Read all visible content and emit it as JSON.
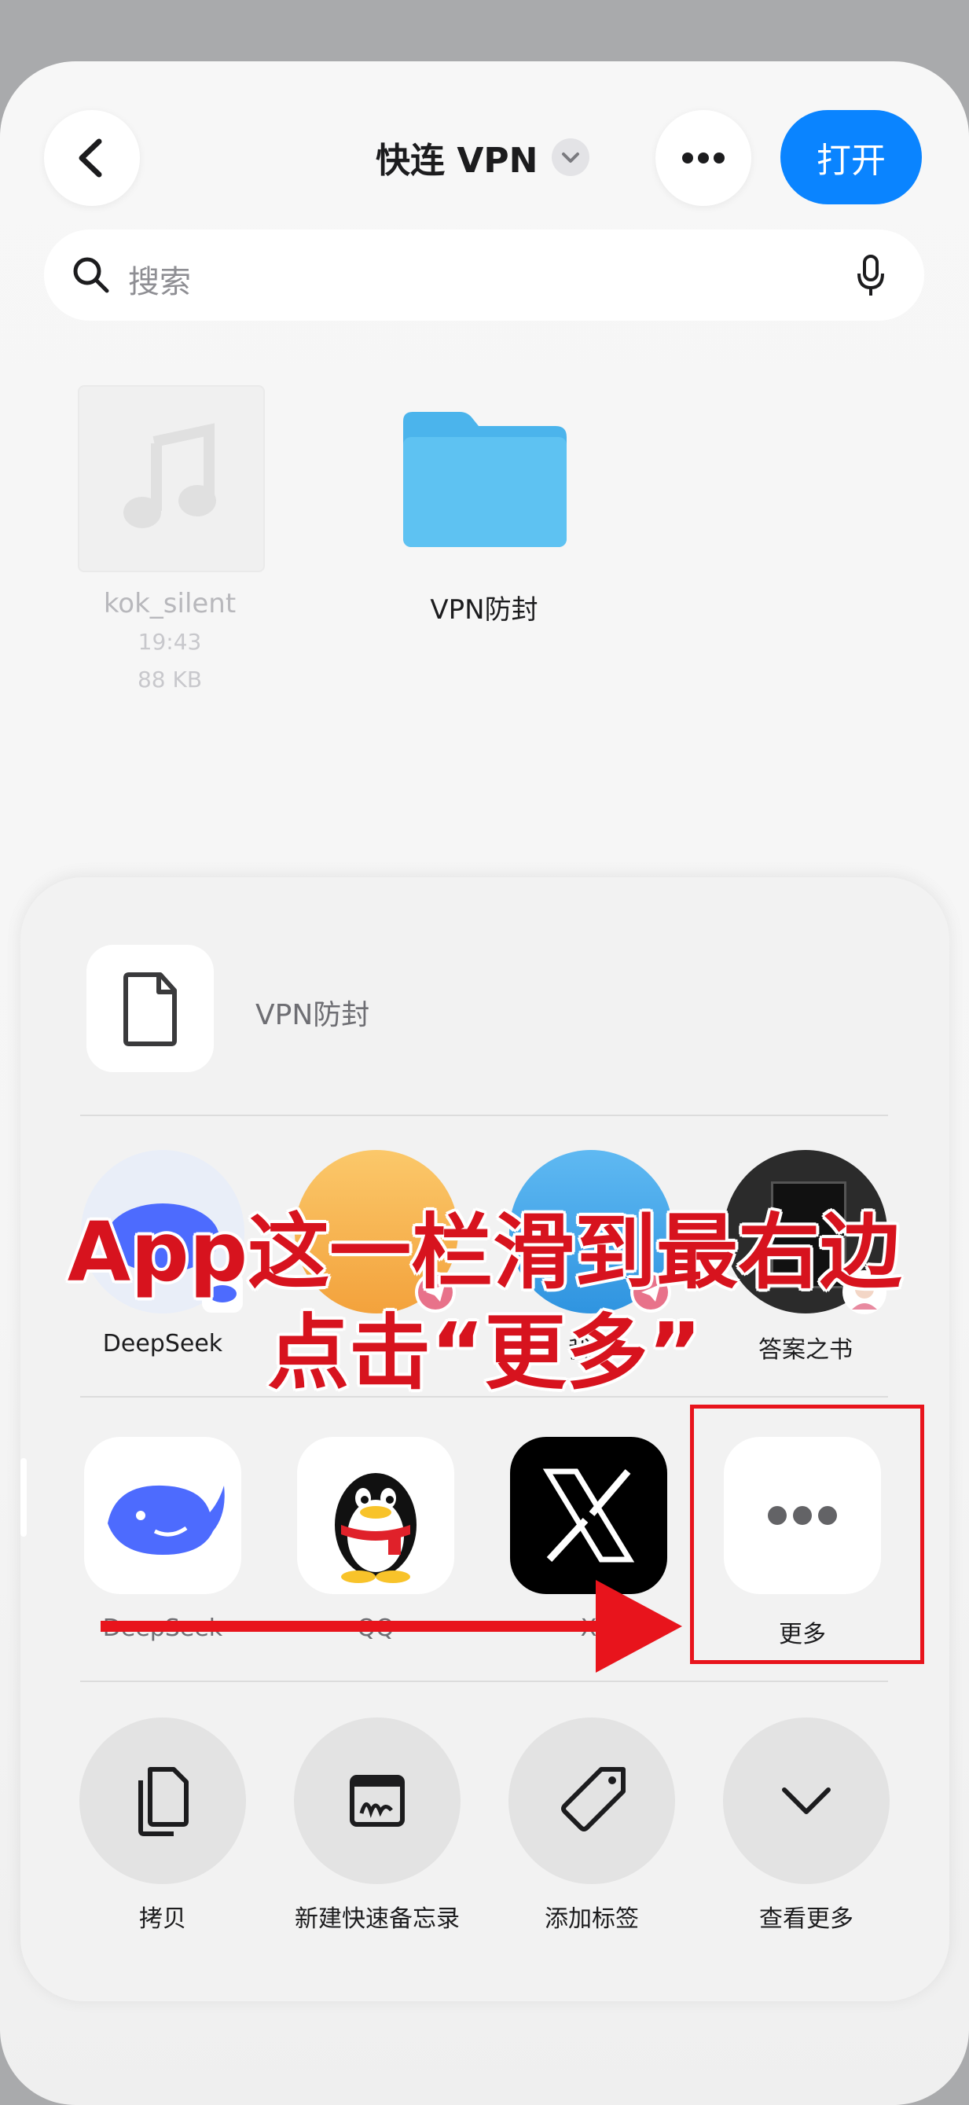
{
  "colors": {
    "accent": "#0a84ff",
    "annotation": "#d7131e"
  },
  "header": {
    "back_icon": "chevron-left-icon",
    "title": "快连 VPN",
    "more_icon": "ellipsis-icon",
    "open_label": "打开"
  },
  "search": {
    "placeholder": "搜索",
    "search_icon": "search-icon",
    "mic_icon": "microphone-icon"
  },
  "files": [
    {
      "name": "kok_silent",
      "time": "19:43",
      "size": "88 KB",
      "icon": "music-note-icon"
    },
    {
      "name": "VPN防封",
      "icon": "folder-icon"
    }
  ],
  "share_sheet": {
    "item_name": "VPN防封",
    "contacts": [
      {
        "label": "DeepSeek"
      },
      {
        "label": ""
      },
      {
        "label": "我的"
      },
      {
        "label": "答案之书"
      }
    ],
    "apps": [
      {
        "label": "DeepSeek",
        "icon": "deepseek-whale-icon"
      },
      {
        "label": "QQ",
        "icon": "qq-penguin-icon"
      },
      {
        "label": "X",
        "icon": "x-logo-icon"
      },
      {
        "label": "更多",
        "icon": "more-dots-icon"
      }
    ],
    "actions": [
      {
        "label": "拷贝",
        "icon": "copy-icon"
      },
      {
        "label": "新建快速备忘录",
        "icon": "quick-note-icon"
      },
      {
        "label": "添加标签",
        "icon": "tag-icon"
      },
      {
        "label": "查看更多",
        "icon": "chevron-down-icon"
      }
    ]
  },
  "annotation": {
    "line1": "App这一栏滑到最右边",
    "line2": "点击“更多”"
  }
}
